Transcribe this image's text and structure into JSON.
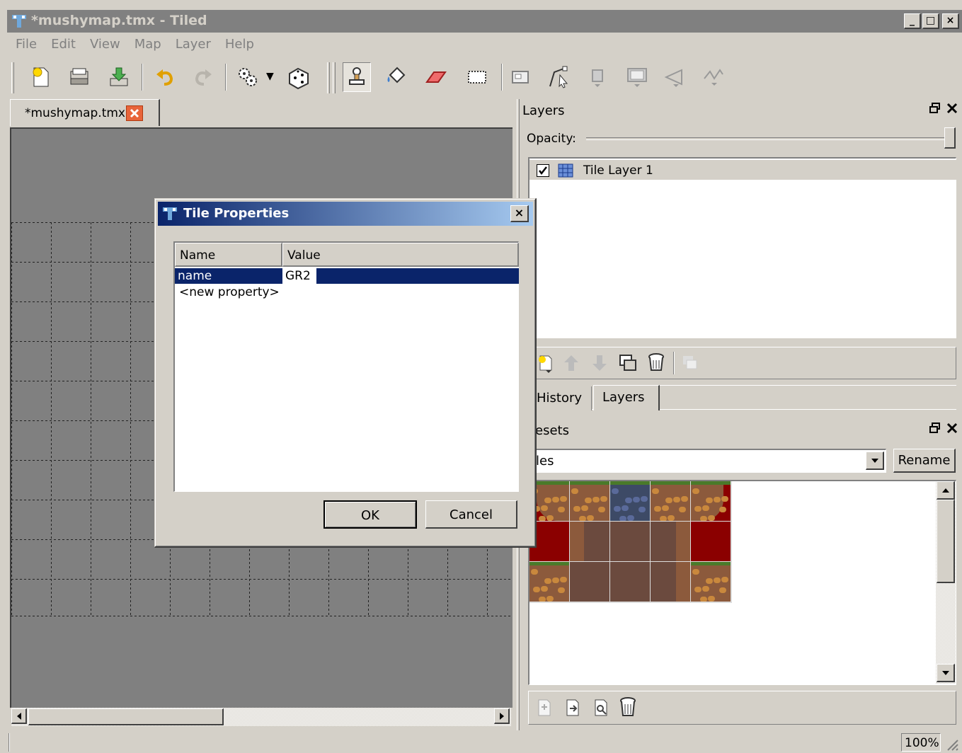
{
  "window": {
    "title": "*mushymap.tmx - Tiled",
    "caption_buttons": {
      "minimize": "_",
      "maximize": "□",
      "close": "×"
    }
  },
  "menu": [
    "File",
    "Edit",
    "View",
    "Map",
    "Layer",
    "Help"
  ],
  "toolbar": {
    "icons": [
      "new-file-icon",
      "open-file-icon",
      "save-icon",
      "undo-icon",
      "redo-icon",
      "command-gears-icon",
      "random-dice-icon",
      "stamp-brush-icon",
      "bucket-fill-icon",
      "eraser-icon",
      "rectangle-select-icon",
      "object-select-icon",
      "edit-polygon-icon",
      "insert-object-icon",
      "insert-tile-object-icon",
      "insert-polygon-icon",
      "insert-polyline-icon"
    ],
    "dropdown_arrow": "▼"
  },
  "document_tab": {
    "label": "*mushymap.tmx"
  },
  "status": {
    "zoom": "100%"
  },
  "layers_panel": {
    "title": "Layers",
    "opacity_label": "Opacity:",
    "opacity_value": 1.0,
    "layers": [
      {
        "name": "Tile Layer 1",
        "visible": true
      }
    ],
    "tabs": [
      "History",
      "Layers"
    ],
    "active_tab": "Layers"
  },
  "tilesets_panel": {
    "title": "esets",
    "tileset": "iles",
    "rename_label": "Rename"
  },
  "dialog": {
    "title": "Tile Properties",
    "close": "×",
    "columns": [
      "Name",
      "Value"
    ],
    "rows": [
      {
        "name": "name",
        "value": "GR2"
      }
    ],
    "new_property": "<new property>",
    "ok_label": "OK",
    "cancel_label": "Cancel"
  },
  "colors": {
    "dialog_title_start": "#0a246a",
    "dialog_title_end": "#a6caf0",
    "selection": "#0a246a",
    "tile_red": "#8b0000",
    "tile_dirt": "#8c5a3c",
    "map_bg": "#808080"
  }
}
